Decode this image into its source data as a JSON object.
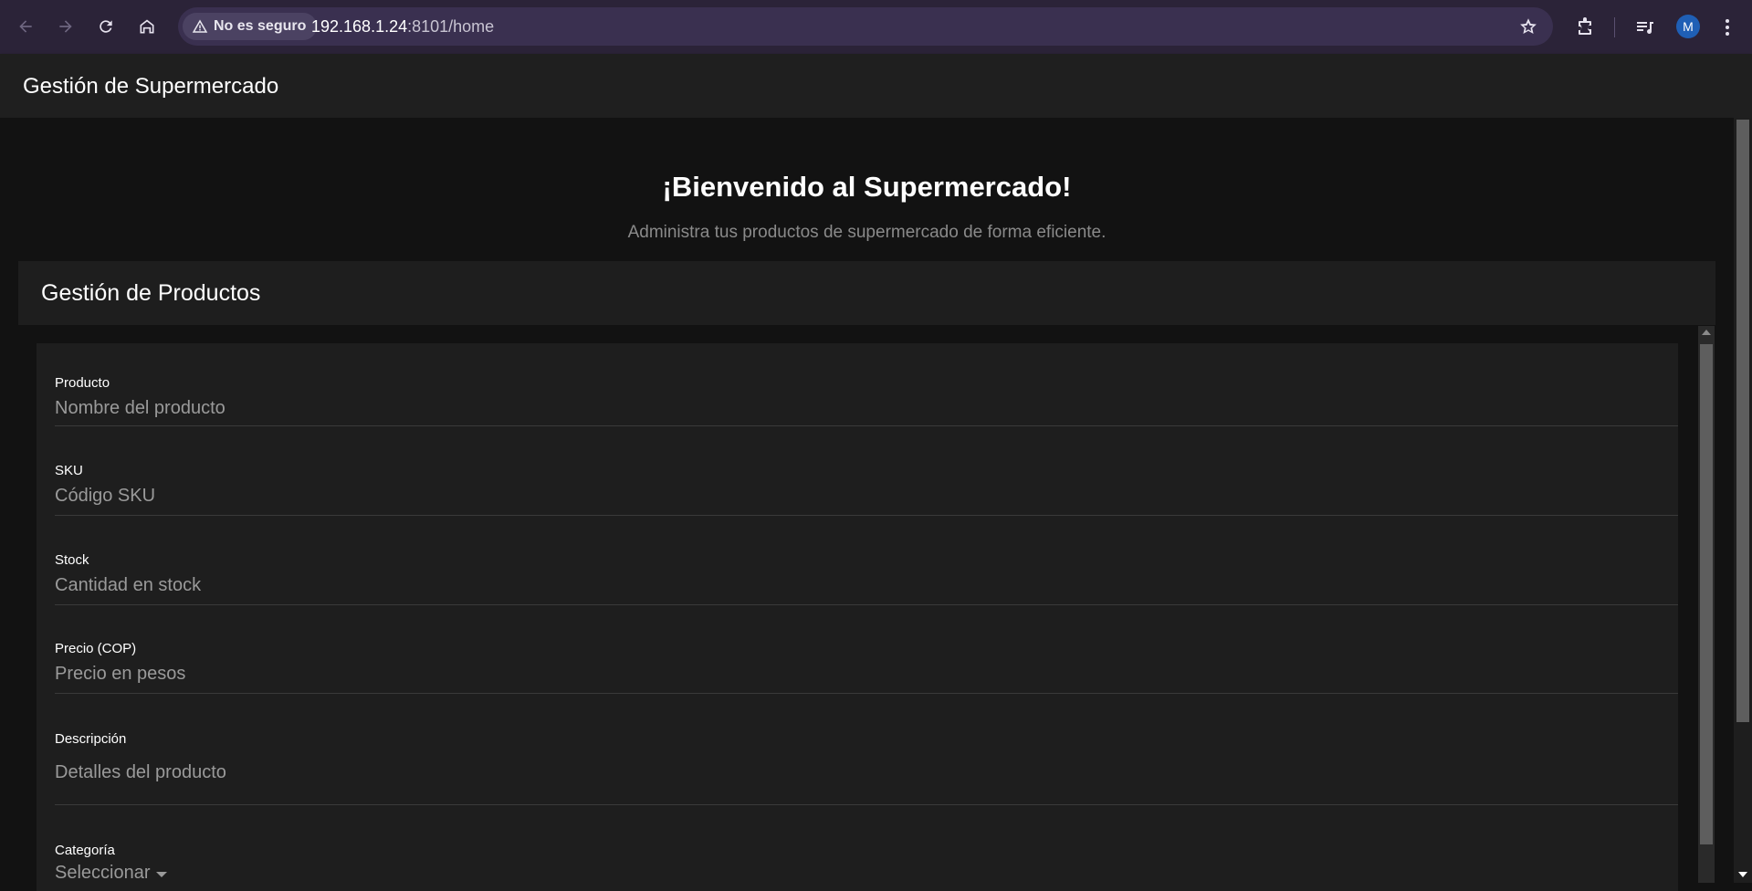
{
  "browser": {
    "security_label": "No es seguro",
    "url_host": "192.168.1.24",
    "url_rest": ":8101/home",
    "profile_initial": "M"
  },
  "app": {
    "title": "Gestión de Supermercado"
  },
  "welcome": {
    "title": "¡Bienvenido al Supermercado!",
    "subtitle": "Administra tus productos de supermercado de forma eficiente."
  },
  "card": {
    "title": "Gestión de Productos"
  },
  "form": {
    "fields": [
      {
        "label": "Producto",
        "placeholder": "Nombre del producto",
        "value": ""
      },
      {
        "label": "SKU",
        "placeholder": "Código SKU",
        "value": ""
      },
      {
        "label": "Stock",
        "placeholder": "Cantidad en stock",
        "value": ""
      },
      {
        "label": "Precio (COP)",
        "placeholder": "Precio en pesos",
        "value": ""
      },
      {
        "label": "Descripción",
        "placeholder": "Detalles del producto",
        "value": ""
      }
    ],
    "category": {
      "label": "Categoría",
      "selected": "Seleccionar"
    }
  },
  "colors": {
    "browser_bar": "#2b2338",
    "omnibox": "#3a3050",
    "toolbar": "#1f1f1f",
    "background": "#121212",
    "card": "#1e1e1e",
    "avatar": "#1f5fb5"
  }
}
